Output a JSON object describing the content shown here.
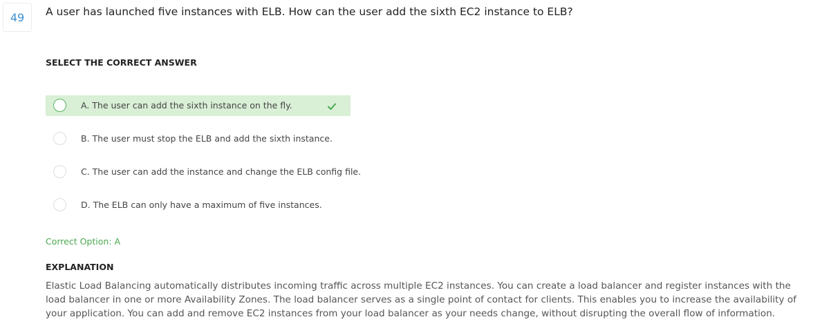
{
  "question": {
    "number": "49",
    "text": "A user has launched five instances with ELB. How can the user add the sixth EC2 instance to ELB?"
  },
  "select_heading": "SELECT THE CORRECT ANSWER",
  "options": [
    {
      "label": "A. The user can add the sixth instance on the fly.",
      "correct": true
    },
    {
      "label": "B. The user must stop the ELB and add the sixth instance.",
      "correct": false
    },
    {
      "label": "C. The user can add the instance and change the ELB config file.",
      "correct": false
    },
    {
      "label": "D. The ELB can only have a maximum of five instances.",
      "correct": false
    }
  ],
  "correct_option_text": "Correct Option: A",
  "explanation": {
    "heading": "EXPLANATION",
    "text": "Elastic Load Balancing automatically distributes incoming traffic across multiple EC2 instances. You can create a load balancer and register instances with the load balancer in one or more Availability Zones. The load balancer serves as a single point of contact for clients. This enables you to increase the availability of your application. You can add and remove EC2 instances from your load balancer as your needs change, without disrupting the overall flow of information."
  },
  "colors": {
    "accent_blue": "#3d8fd1",
    "correct_green": "#4aa84f",
    "correct_bg": "#d9efd6"
  },
  "icons": {
    "radio": "radio-circle-icon",
    "check": "checkmark-icon"
  }
}
